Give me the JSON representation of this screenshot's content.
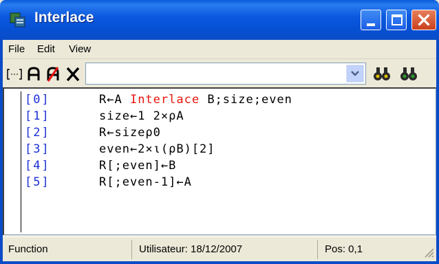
{
  "window": {
    "title": "Interlace",
    "accent": "#0a4cc8"
  },
  "menu": {
    "file": "File",
    "edit": "Edit",
    "view": "View"
  },
  "toolbar": {
    "combo_value": "",
    "icons": [
      "bracket-icon",
      "letter-a-icon",
      "letter-a-crossed-icon",
      "close-x-icon",
      "dropdown-chevron-icon",
      "find-binoculars-icon",
      "find-next-binoculars-icon"
    ]
  },
  "editor": {
    "lines": [
      {
        "num": "[0]",
        "code_pre": "R←A ",
        "code_kw": "Interlace",
        "code_post": " B;size;even"
      },
      {
        "num": "[1]",
        "code_pre": "size←1 2×ρA",
        "code_kw": "",
        "code_post": ""
      },
      {
        "num": "[2]",
        "code_pre": "R←sizeρ0",
        "code_kw": "",
        "code_post": ""
      },
      {
        "num": "[3]",
        "code_pre": "even←2×ι(ρB)[2]",
        "code_kw": "",
        "code_post": ""
      },
      {
        "num": "[4]",
        "code_pre": "R[;even]←B",
        "code_kw": "",
        "code_post": ""
      },
      {
        "num": "[5]",
        "code_pre": "R[;even-1]←A",
        "code_kw": "",
        "code_post": ""
      }
    ]
  },
  "status": {
    "type": "Function",
    "user": "Utilisateur: 18/12/2007",
    "pos": "Pos: 0,1"
  }
}
